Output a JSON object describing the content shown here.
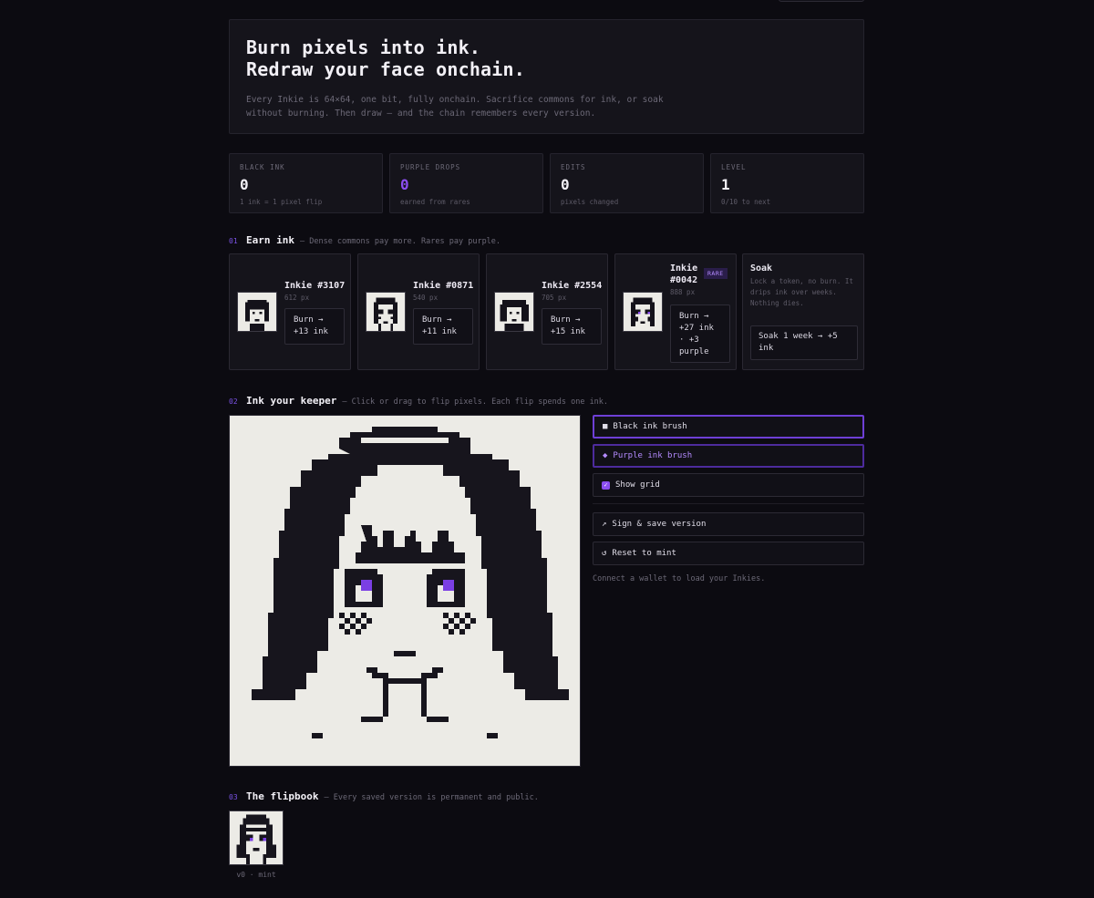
{
  "hero": {
    "title_line1": "Burn pixels into ink.",
    "title_line2": "Redraw your face onchain.",
    "description": "Every Inkie is 64×64, one bit, fully onchain. Sacrifice commons for ink, or soak without burning. Then draw — and the chain remembers every version."
  },
  "stats": [
    {
      "label": "BLACK INK",
      "value": "0",
      "sub": "1 ink = 1 pixel flip"
    },
    {
      "label": "PURPLE DROPS",
      "value": "0",
      "sub": "earned from rares"
    },
    {
      "label": "EDITS",
      "value": "0",
      "sub": "pixels changed"
    },
    {
      "label": "LEVEL",
      "value": "1",
      "sub": "0/10 to next"
    }
  ],
  "sections": {
    "earn": {
      "num": "01",
      "title": "Earn ink",
      "desc": "— Dense commons pay more. Rares pay purple."
    },
    "keeper": {
      "num": "02",
      "title": "Ink your keeper",
      "desc": "— Click or drag to flip pixels. Each flip spends one ink."
    },
    "flipbook": {
      "num": "03",
      "title": "The flipbook",
      "desc": "— Every saved version is permanent and public."
    }
  },
  "cards": [
    {
      "name": "Inkie #3107",
      "px": "612 px",
      "button": "Burn → +13 ink"
    },
    {
      "name": "Inkie #0871",
      "px": "540 px",
      "button": "Burn → +11 ink"
    },
    {
      "name": "Inkie #2554",
      "px": "705 px",
      "button": "Burn → +15 ink"
    },
    {
      "name": "Inkie #0042",
      "px": "888 px",
      "badge": "RARE",
      "button": "Burn → +27 ink · +3 purple"
    }
  ],
  "soak": {
    "title": "Soak",
    "desc": "Lock a token, no burn. It drips ink over weeks. Nothing dies.",
    "button": "Soak 1 week → +5 ink"
  },
  "tools": {
    "black_brush": "Black ink brush",
    "black_brush_glyph": "■",
    "purple_brush": "Purple ink brush",
    "purple_brush_glyph": "◆",
    "show_grid": "Show grid",
    "show_grid_checked": true,
    "save": "Sign & save version",
    "save_glyph": "↗",
    "reset": "Reset to mint",
    "reset_glyph": "↺",
    "connect_note": "Connect a wallet to load your Inkies."
  },
  "flipbook": {
    "caption": "v0 · mint"
  },
  "colors": {
    "background": "#0c0b11",
    "panel": "#15141b",
    "accent_purple": "#8b4ef0",
    "ink": "#14121a",
    "paper": "#ecebe6"
  }
}
